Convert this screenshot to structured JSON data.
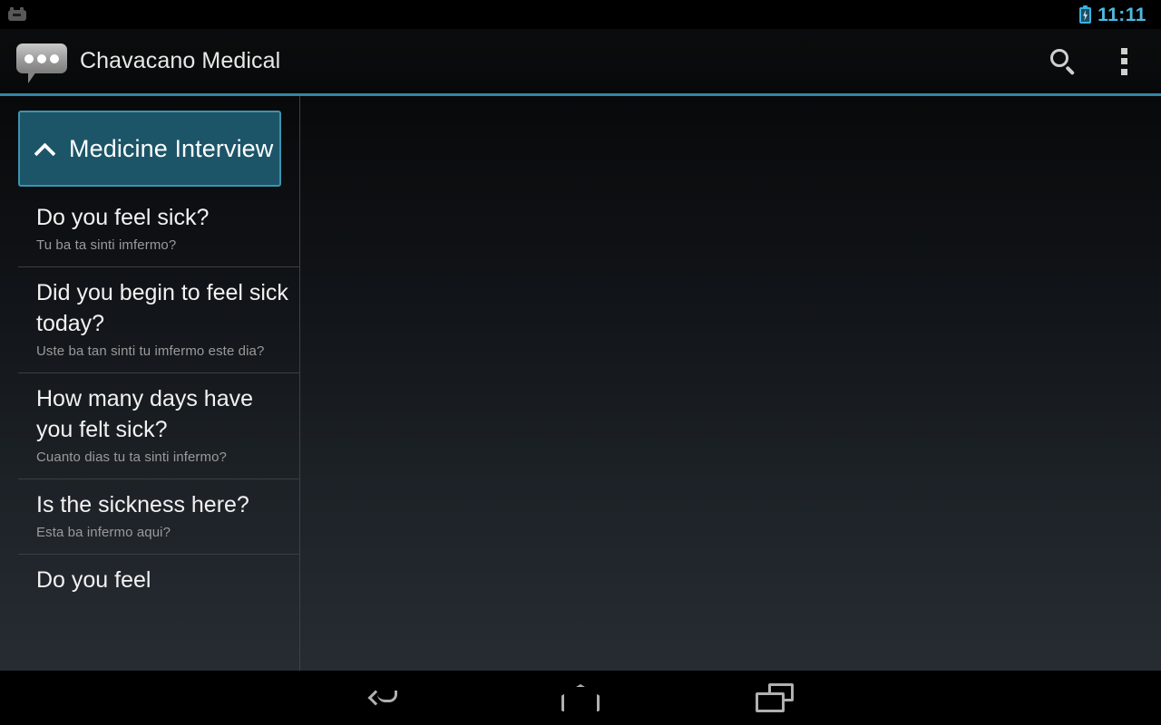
{
  "status_bar": {
    "notification_icon": "notification-icon",
    "battery_icon": "battery-charging-icon",
    "time": "11:11",
    "time_color": "#4fb9e0"
  },
  "action_bar": {
    "app_icon": "speech-bubble-icon",
    "title": "Chavacano Medical",
    "search_icon": "search-icon",
    "overflow_icon": "overflow-menu-icon",
    "accent_color": "#2f87a8"
  },
  "list_pane": {
    "group_header": {
      "label": "Medicine Interview",
      "chevron_icon": "chevron-up-icon",
      "expanded": true,
      "background_color": "#1c5568",
      "border_color": "#3e93b0"
    },
    "items": [
      {
        "primary": "Do you feel sick?",
        "secondary": "Tu ba ta sinti imfermo?"
      },
      {
        "primary": "Did you begin to feel sick today?",
        "secondary": "Uste ba tan sinti tu imfermo este dia?"
      },
      {
        "primary": "How many days have you felt sick?",
        "secondary": "Cuanto dias tu ta sinti infermo?"
      },
      {
        "primary": "Is the sickness here?",
        "secondary": "Esta ba infermo aqui?"
      },
      {
        "primary": "Do you feel",
        "secondary": ""
      }
    ]
  },
  "detail_pane": {
    "content": ""
  },
  "nav_bar": {
    "back_icon": "back-icon",
    "home_icon": "home-icon",
    "recents_icon": "recent-apps-icon"
  }
}
